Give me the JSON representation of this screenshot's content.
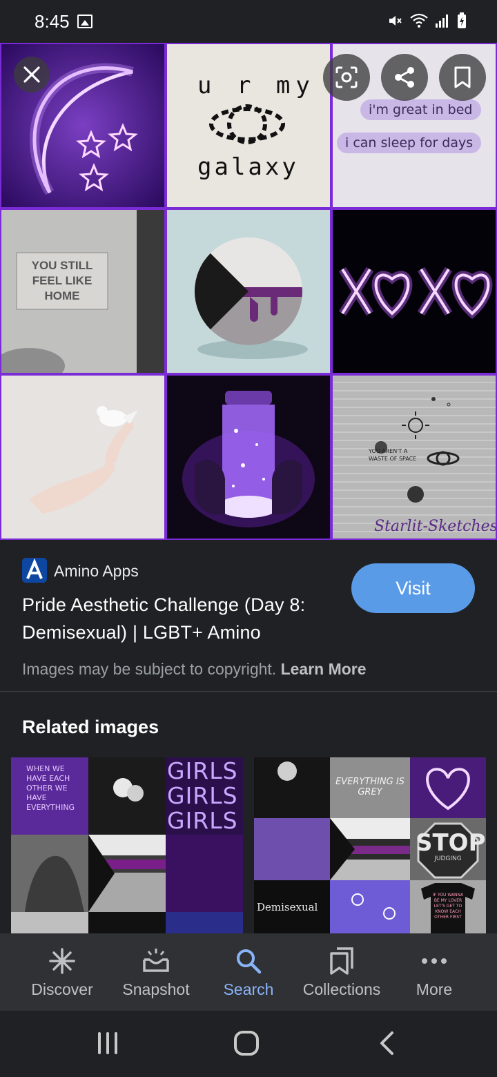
{
  "status_bar": {
    "time": "8:45"
  },
  "hero": {
    "tiles": {
      "t2_text": "u r my",
      "t2_text2": "galaxy",
      "t3_bubble1": "i'm great in bed",
      "t3_bubble2": "i can sleep for days",
      "t4_sign": "YOU STILL FEEL LIKE HOME",
      "t9_text": "YOU AREN'T A WASTE OF SPACE",
      "t9_sig": "Starlit-Sketches"
    },
    "buttons": [
      "close-icon",
      "lens-icon",
      "share-icon",
      "bookmark-icon"
    ]
  },
  "result": {
    "source": "Amino Apps",
    "title": "Pride Aesthetic Challenge (Day 8: Demisexual) | LGBT+ Amino",
    "visit_label": "Visit",
    "copyright_text": "Images may be subject to copyright.",
    "learn_more": "Learn More"
  },
  "related": {
    "title": "Related images",
    "r1_text_girls": "GIRLS",
    "r1_text_wall": "WHEN WE HAVE EACH OTHER WE HAVE EVERYTHING",
    "r2_text_grey": "EVERYTHING IS GREY",
    "r2_text_stop": "STOP",
    "r2_text_judging": "JUDGING",
    "r2_text_demi": "Demisexual",
    "r2_text_shirt": "IF YOU WANNA BE MY LOVER LET'S GET TO KNOW EACH OTHER FIRST"
  },
  "bottom_nav": {
    "items": [
      {
        "label": "Discover",
        "icon": "asterisk-icon"
      },
      {
        "label": "Snapshot",
        "icon": "snapshot-icon"
      },
      {
        "label": "Search",
        "icon": "search-icon",
        "active": true
      },
      {
        "label": "Collections",
        "icon": "collections-icon"
      },
      {
        "label": "More",
        "icon": "more-icon"
      }
    ]
  },
  "colors": {
    "accent": "#8ab4f8",
    "visit": "#5a9be8",
    "collage_border": "#7a2bd6",
    "background": "#202124"
  }
}
